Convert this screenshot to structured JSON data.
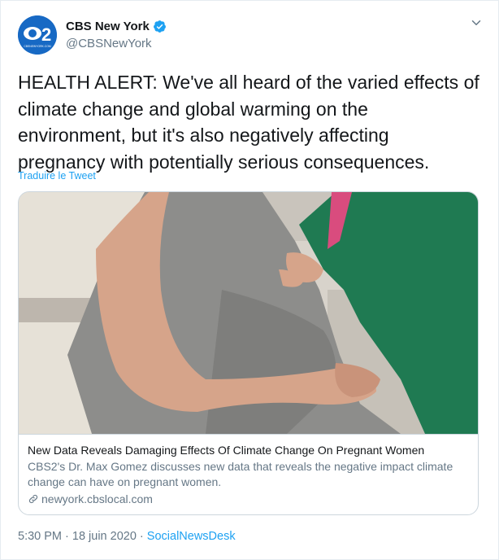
{
  "author": {
    "name": "CBS New York",
    "handle": "@CBSNewYork",
    "avatar_text": "2",
    "avatar_subtext": "CBSNEWYORK.COM"
  },
  "tweet": {
    "text": "HEALTH ALERT: We've all heard of the varied effects of climate change and global warming on the environment, but it's also negatively affecting pregnancy with potentially serious consequences.",
    "translate_label": "Traduire le Tweet"
  },
  "card": {
    "title": "New Data Reveals Damaging Effects Of Climate Change On Pregnant Women",
    "description": "CBS2's Dr. Max Gomez discusses new data that reveals the negative impact climate change can have on pregnant women.",
    "domain": "newyork.cbslocal.com"
  },
  "meta": {
    "time": "5:30 PM",
    "sep1": " · ",
    "date": "18 juin 2020",
    "sep2": " · ",
    "source": "SocialNewsDesk"
  },
  "colors": {
    "accent": "#1da1f2",
    "avatar_bg": "#1769c4",
    "text": "#14171a",
    "muted": "#657786"
  },
  "icons": {
    "verified": "verified-badge-icon",
    "chevron": "chevron-down-icon",
    "link": "link-icon"
  }
}
